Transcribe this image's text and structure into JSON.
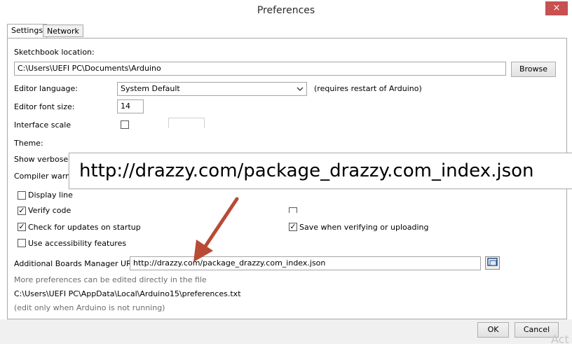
{
  "window": {
    "title": "Preferences",
    "close": "×"
  },
  "tabs": [
    {
      "label": "Settings"
    },
    {
      "label": "Network"
    }
  ],
  "sketchbook": {
    "label": "Sketchbook location:",
    "value": "C:\\Users\\UEFI PC\\Documents\\Arduino",
    "browse": "Browse"
  },
  "editor_language": {
    "label": "Editor language:",
    "value": "System Default",
    "note": "(requires restart of Arduino)"
  },
  "font_size": {
    "label": "Editor font size:",
    "value": "14"
  },
  "interface_scale": {
    "label": "Interface scale"
  },
  "theme": {
    "label": "Theme:"
  },
  "verbose": {
    "label": "Show verbose"
  },
  "compiler": {
    "label": "Compiler warni"
  },
  "checkboxes": {
    "display_line": {
      "label": "Display line",
      "checked": false
    },
    "verify_code": {
      "label": "Verify code",
      "checked": true
    },
    "check_updates": {
      "label": "Check for updates on startup",
      "checked": true
    },
    "save_verify": {
      "label": "Save when verifying or uploading",
      "checked": true
    },
    "accessibility": {
      "label": "Use accessibility features",
      "checked": false
    }
  },
  "boards_url": {
    "label": "Additional Boards Manager URLs:",
    "value": "http://drazzy.com/package_drazzy.com_index.json"
  },
  "zoom": {
    "text": "http://drazzy.com/package_drazzy.com_index.json"
  },
  "footer_notes": {
    "more": "More preferences can be edited directly in the file",
    "path": "C:\\Users\\UEFI PC\\AppData\\Local\\Arduino15\\preferences.txt",
    "edit_only": "(edit only when Arduino is not running)"
  },
  "buttons": {
    "ok": "OK",
    "cancel": "Cancel"
  },
  "watermark": "Act",
  "colors": {
    "arrow": "#b84a36",
    "close_bg": "#c75050"
  }
}
